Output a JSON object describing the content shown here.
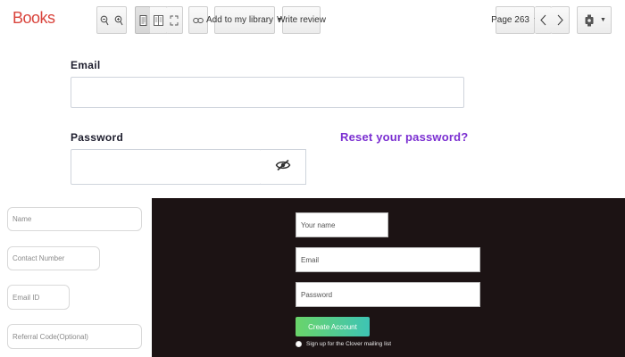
{
  "toolbar": {
    "brand": "Books",
    "add_library_label": "Add to my library",
    "write_review_label": "Write review",
    "page_label": "Page 263"
  },
  "login_form": {
    "email_label": "Email",
    "email_value": "",
    "password_label": "Password",
    "password_value": "",
    "reset_link": "Reset your password?"
  },
  "contact_form": {
    "name_placeholder": "Name",
    "contact_placeholder": "Contact Number",
    "email_placeholder": "Email ID",
    "referral_placeholder": "Referral Code(Optional)"
  },
  "signup_form": {
    "name_placeholder": "Your name",
    "email_placeholder": "Email",
    "password_placeholder": "Password",
    "create_button": "Create Account",
    "mailing_label": "Sign up for the Clover mailing list"
  },
  "colors": {
    "brand": "#d9443c",
    "link": "#7b2fd1",
    "dark_panel": "#1c1314",
    "button_gradient_start": "#6ad46a",
    "button_gradient_end": "#3ec4b4"
  },
  "icons": [
    "zoom-out-icon",
    "zoom-in-icon",
    "single-page-icon",
    "two-page-icon",
    "fullscreen-icon",
    "link-icon",
    "previous-page-icon",
    "next-page-icon",
    "settings-gear-icon",
    "hide-password-icon"
  ]
}
